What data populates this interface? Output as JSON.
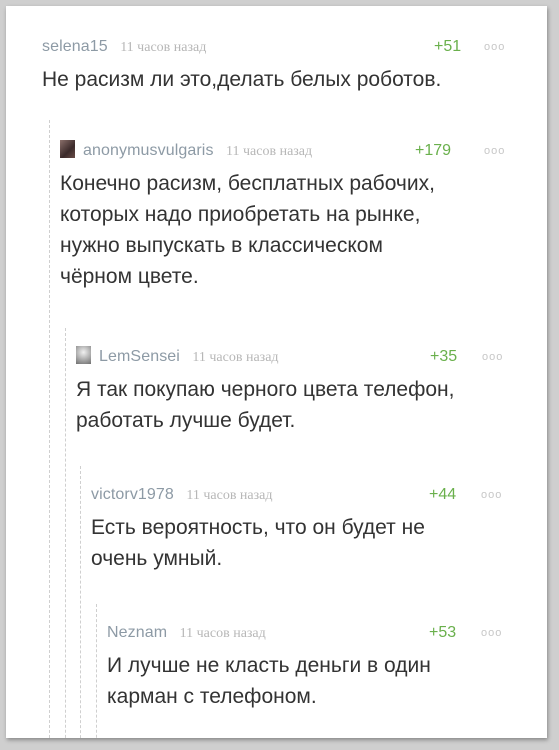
{
  "comments": [
    {
      "user": "selena15",
      "time": "11 часов назад",
      "rating": "+51",
      "text": "Не расизм ли это,делать белых роботов."
    },
    {
      "user": "anonymusvulgaris",
      "time": "11 часов назад",
      "rating": "+179",
      "text": "Конечно расизм, бесплатных рабочих,\nкоторых надо приобретать на рынке,\nнужно выпускать в классическом\nчёрном цвете."
    },
    {
      "user": "LemSensei",
      "time": "11 часов назад",
      "rating": "+35",
      "text": "Я так покупаю черного цвета телефон,\nработать лучше будет."
    },
    {
      "user": "victorv1978",
      "time": "11 часов назад",
      "rating": "+44",
      "text": "Есть вероятность, что он будет не\nочень умный."
    },
    {
      "user": "Neznam",
      "time": "11 часов назад",
      "rating": "+53",
      "text": "И лучше не класть деньги в один\nкарман с телефоном."
    }
  ],
  "more_icon": "ooo",
  "colors": {
    "username": "#8d9aa5",
    "rating": "#6ab04c",
    "text": "#333333",
    "time": "#b7b7b7"
  }
}
